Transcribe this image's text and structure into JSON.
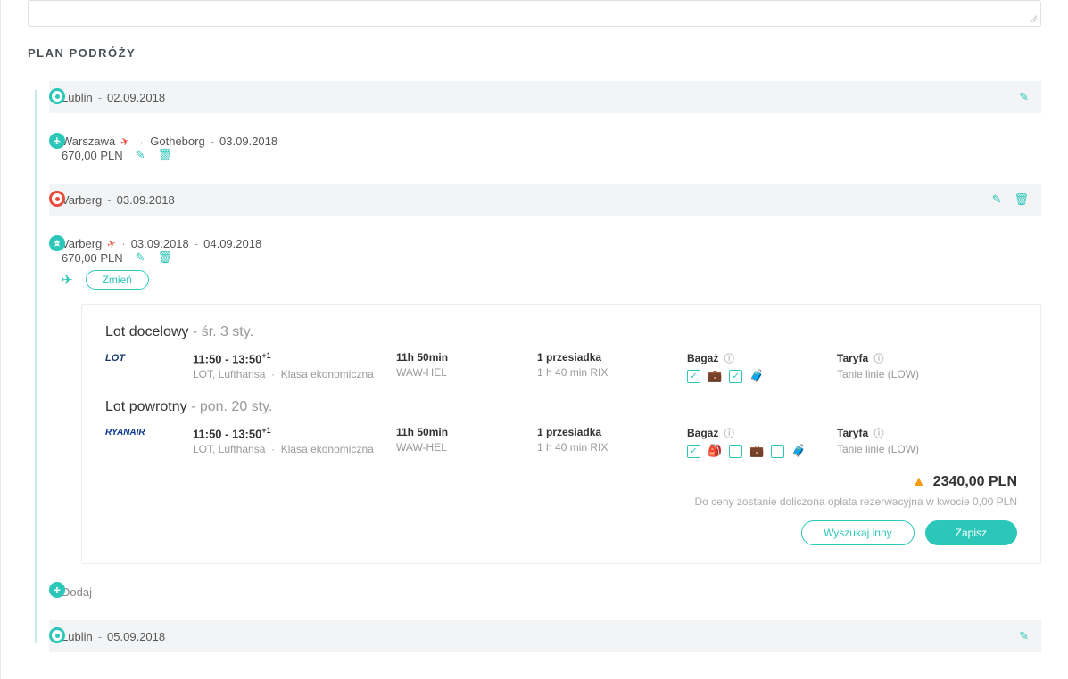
{
  "section_title": "PLAN PODRÓŻY",
  "items": [
    {
      "city": "Lublin",
      "date": "02.09.2018"
    },
    {
      "from": "Warszawa",
      "to": "Gotheborg",
      "date": "03.09.2018",
      "price": "670,00 PLN"
    },
    {
      "city": "Varberg",
      "date": "03.09.2018"
    },
    {
      "city": "Varberg",
      "date1": "03.09.2018",
      "date2": "04.09.2018",
      "price": "670,00 PLN",
      "change": "Zmień"
    }
  ],
  "flight": {
    "out_title": "Lot docelowy",
    "out_date": "śr. 3 sty.",
    "ret_title": "Lot powrotny",
    "ret_date": "pon. 20 sty.",
    "out_logo": "LOT",
    "ret_logo": "RYANAIR",
    "times": "11:50  -  13:50",
    "plus": "+1",
    "carriers": "LOT, Lufthansa",
    "class_sep": "·",
    "class": "Klasa ekonomiczna",
    "duration": "11h 50min",
    "route": "WAW-HEL",
    "stops_hd": "1 przesiadka",
    "stops_sub": "1 h  40 min RIX",
    "bag_hd": "Bagaż",
    "tariff_hd": "Taryfa",
    "tariff": "Tanie linie (LOW)",
    "total": "2340,00 PLN",
    "note": "Do ceny zostanie doliczona opłata rezerwacyjna w kwocie 0,00 PLN",
    "search": "Wyszukaj inny",
    "save": "Zapisz"
  },
  "add": "Dodaj",
  "end": {
    "city": "Lublin",
    "date": "05.09.2018"
  }
}
